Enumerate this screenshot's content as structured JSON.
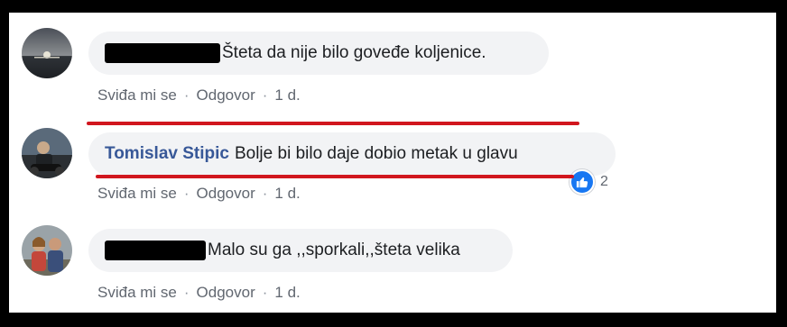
{
  "comments": [
    {
      "author": "",
      "text": "Šteta da nije bilo goveđe koljenice.",
      "actions": {
        "like": "Sviđa mi se",
        "reply": "Odgovor",
        "time": "1 d."
      }
    },
    {
      "author": "Tomislav Stipic",
      "text": "Bolje bi bilo daje dobio metak u glavu",
      "actions": {
        "like": "Sviđa mi se",
        "reply": "Odgovor",
        "time": "1 d."
      },
      "reactions": {
        "icon": "thumbs-up-icon",
        "count": "2"
      }
    },
    {
      "author": "",
      "text": "Malo su ga ,,sporkali,,šteta velika",
      "actions": {
        "like": "Sviđa mi se",
        "reply": "Odgovor",
        "time": "1 d."
      }
    }
  ],
  "colors": {
    "author_link": "#385898",
    "bubble_bg": "#f2f3f5",
    "meta_text": "#616770",
    "annotation_red": "#d1161e",
    "like_blue": "#1877f2"
  }
}
